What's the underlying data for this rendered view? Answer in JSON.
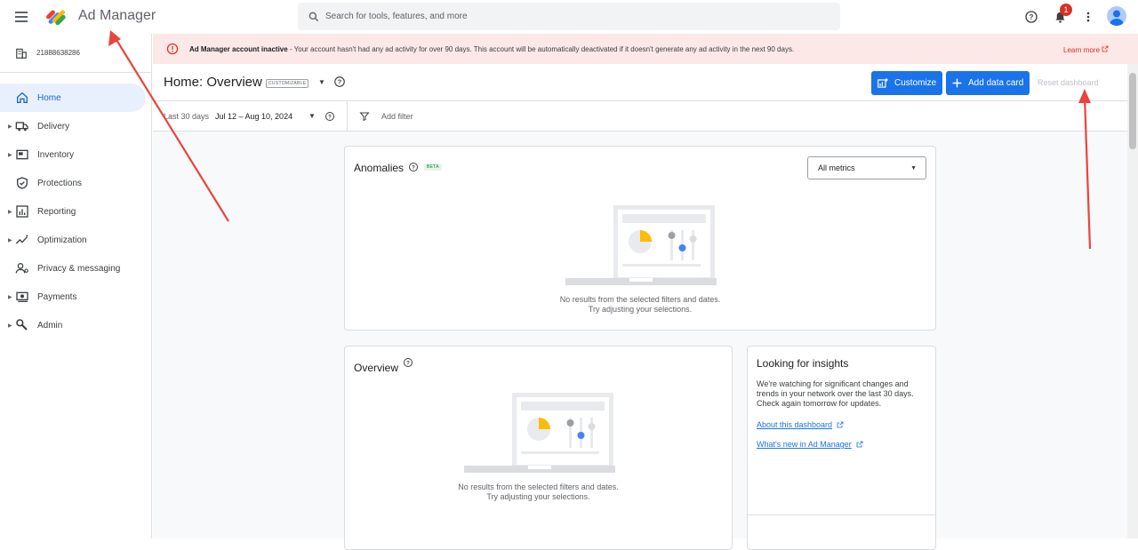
{
  "header": {
    "app_title": "Ad Manager",
    "search_placeholder": "Search for tools, features, and more",
    "notification_count": "1"
  },
  "sidebar": {
    "network_id": "21888638286",
    "items": [
      {
        "label": "Home",
        "icon": "home-icon",
        "expandable": false,
        "active": true
      },
      {
        "label": "Delivery",
        "icon": "truck-icon",
        "expandable": true
      },
      {
        "label": "Inventory",
        "icon": "inventory-icon",
        "expandable": true
      },
      {
        "label": "Protections",
        "icon": "shield-icon",
        "expandable": false
      },
      {
        "label": "Reporting",
        "icon": "bar-chart-icon",
        "expandable": true
      },
      {
        "label": "Optimization",
        "icon": "trend-icon",
        "expandable": true
      },
      {
        "label": "Privacy & messaging",
        "icon": "person-settings-icon",
        "expandable": false
      },
      {
        "label": "Payments",
        "icon": "money-icon",
        "expandable": true
      },
      {
        "label": "Admin",
        "icon": "wrench-icon",
        "expandable": true
      }
    ]
  },
  "banner": {
    "title": "Ad Manager account inactive",
    "message": " - Your account hasn't had any ad activity for over 90 days. This account will be automatically deactivated if it doesn't generate any ad activity in the next 90 days.",
    "link": "Learn more",
    "color": "#fce8e6"
  },
  "page": {
    "title": "Home: Overview",
    "chip": "CUSTOMIZABLE",
    "customize_label": "Customize",
    "add_card_label": "Add data card",
    "reset_label": "Reset dashboard"
  },
  "filters": {
    "date_label": "Last 30 days",
    "date_range": "Jul 12 – Aug 10, 2024",
    "add_filter": "Add filter"
  },
  "anomalies": {
    "title": "Anomalies",
    "badge": "BETA",
    "metric_select": "All metrics",
    "empty_line1": "No results from the selected filters and dates.",
    "empty_line2": "Try adjusting your selections."
  },
  "overview": {
    "title": "Overview",
    "empty_line1": "No results from the selected filters and dates.",
    "empty_line2": "Try adjusting your selections."
  },
  "insights": {
    "title": "Looking for insights",
    "body": "We're watching for significant changes and trends in your network over the last 30 days. Check again tomorrow for updates.",
    "link1": "About this dashboard",
    "link2": "What's new in Ad Manager"
  },
  "colors": {
    "accent": "#1a73e8",
    "active_nav": "#e8f0fe",
    "annotation_arrow": "#e8453c"
  }
}
